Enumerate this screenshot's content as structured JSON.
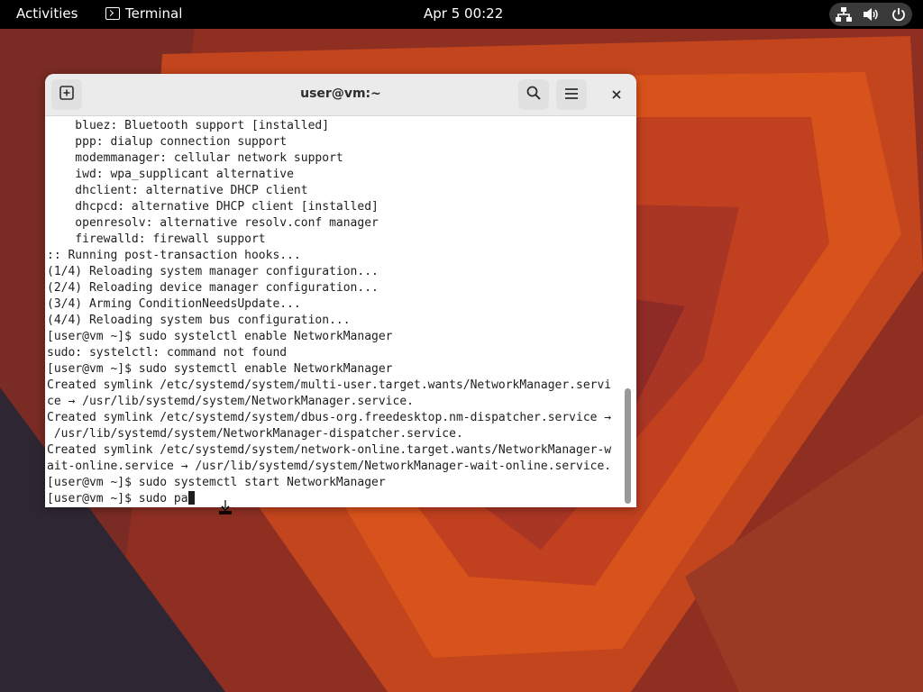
{
  "topbar": {
    "activities": "Activities",
    "app_name": "Terminal",
    "clock": "Apr 5  00:22",
    "status_icons": [
      "network-icon",
      "volume-icon",
      "power-icon"
    ]
  },
  "window": {
    "title": "user@vm:~",
    "buttons": [
      "new-tab-icon",
      "search-icon",
      "hamburger-menu-icon",
      "close-icon"
    ]
  },
  "terminal": {
    "lines": [
      "    bluez: Bluetooth support [installed]",
      "    ppp: dialup connection support",
      "    modemmanager: cellular network support",
      "    iwd: wpa_supplicant alternative",
      "    dhclient: alternative DHCP client",
      "    dhcpcd: alternative DHCP client [installed]",
      "    openresolv: alternative resolv.conf manager",
      "    firewalld: firewall support",
      ":: Running post-transaction hooks...",
      "(1/4) Reloading system manager configuration...",
      "(2/4) Reloading device manager configuration...",
      "(3/4) Arming ConditionNeedsUpdate...",
      "(4/4) Reloading system bus configuration...",
      "[user@vm ~]$ sudo systelctl enable NetworkManager",
      "sudo: systelctl: command not found",
      "[user@vm ~]$ sudo systemctl enable NetworkManager",
      "Created symlink /etc/systemd/system/multi-user.target.wants/NetworkManager.servi",
      "ce → /usr/lib/systemd/system/NetworkManager.service.",
      "Created symlink /etc/systemd/system/dbus-org.freedesktop.nm-dispatcher.service →",
      " /usr/lib/systemd/system/NetworkManager-dispatcher.service.",
      "Created symlink /etc/systemd/system/network-online.target.wants/NetworkManager-w",
      "ait-online.service → /usr/lib/systemd/system/NetworkManager-wait-online.service.",
      "[user@vm ~]$ sudo systemctl start NetworkManager"
    ],
    "prompt": "[user@vm ~]$ sudo pa"
  },
  "colors": {
    "topbar_bg": "#000000",
    "terminal_bg": "#ffffff",
    "terminal_fg": "#1e1e1e",
    "wallpaper_base": "#8e2f22"
  }
}
